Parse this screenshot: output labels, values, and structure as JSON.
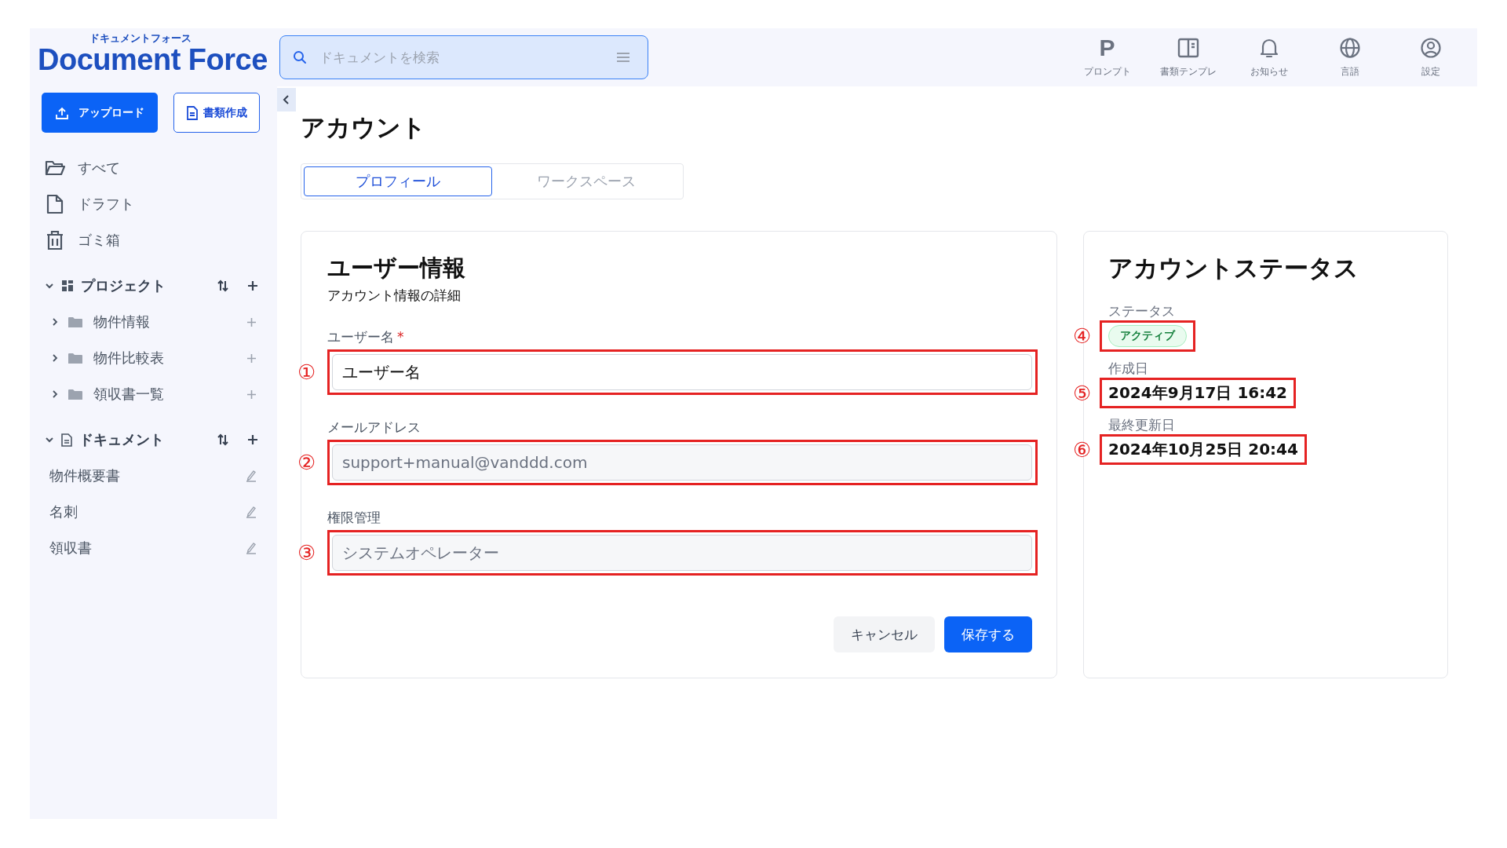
{
  "logo": {
    "kana": "ドキュメントフォース",
    "name": "Document Force"
  },
  "search": {
    "placeholder": "ドキュメントを検索"
  },
  "header_actions": [
    {
      "label": "プロンプト",
      "glyph": "P"
    },
    {
      "label": "書類テンプレ"
    },
    {
      "label": "お知らせ"
    },
    {
      "label": "言語"
    },
    {
      "label": "設定"
    }
  ],
  "sidebar": {
    "buttons": [
      {
        "label": "アップロード",
        "kind": "primary"
      },
      {
        "label": "書類作成",
        "kind": "outline"
      }
    ],
    "nav": [
      {
        "label": "すべて"
      },
      {
        "label": "ドラフト"
      },
      {
        "label": "ゴミ箱"
      }
    ],
    "sections": [
      {
        "title": "プロジェクト",
        "kind": "folders",
        "expanded": true,
        "items": [
          {
            "label": "物件情報",
            "expanded": false
          },
          {
            "label": "物件比較表",
            "expanded": false
          },
          {
            "label": "領収書一覧",
            "expanded": false
          }
        ]
      },
      {
        "title": "ドキュメント",
        "kind": "documents",
        "expanded": true,
        "items": [
          {
            "label": "物件概要書"
          },
          {
            "label": "名刺"
          },
          {
            "label": "領収書"
          }
        ]
      }
    ]
  },
  "page": {
    "title": "アカウント",
    "tabs": [
      {
        "label": "プロフィール",
        "selected": true
      },
      {
        "label": "ワークスペース",
        "selected": false
      }
    ]
  },
  "user_card": {
    "title": "ユーザー情報",
    "subtitle": "アカウント情報の詳細",
    "fields": [
      {
        "label": "ユーザー名",
        "required_mark": "*",
        "value": "ユーザー名",
        "disabled": false,
        "marker": "①"
      },
      {
        "label": "メールアドレス",
        "value": "support+manual@vanddd.com",
        "disabled": true,
        "marker": "②"
      },
      {
        "label": "権限管理",
        "value": "システムオペレーター",
        "disabled": true,
        "marker": "③"
      }
    ],
    "buttons": [
      {
        "label": "キャンセル",
        "kind": "secondary"
      },
      {
        "label": "保存する",
        "kind": "primary"
      }
    ]
  },
  "status_card": {
    "title": "アカウントステータス",
    "items": [
      {
        "label": "ステータス",
        "kind": "badge",
        "value": "アクティブ",
        "marker": "④"
      },
      {
        "label": "作成日",
        "kind": "text",
        "value": "2024年9月17日 16:42",
        "marker": "⑤"
      },
      {
        "label": "最終更新日",
        "kind": "text",
        "value": "2024年10月25日 20:44",
        "marker": "⑥"
      }
    ]
  }
}
